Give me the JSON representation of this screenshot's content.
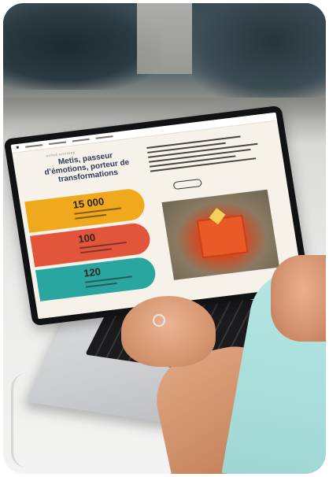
{
  "screen": {
    "kicker": "NOTRE HISTOIRE",
    "headline": "Metis, passeur d’émotions, porteur de transformations",
    "stats": [
      {
        "value": "15 000",
        "color": "#f0a81c"
      },
      {
        "value": "100",
        "color": "#e2553a"
      },
      {
        "value": "120",
        "color": "#2aa6a0"
      }
    ]
  }
}
